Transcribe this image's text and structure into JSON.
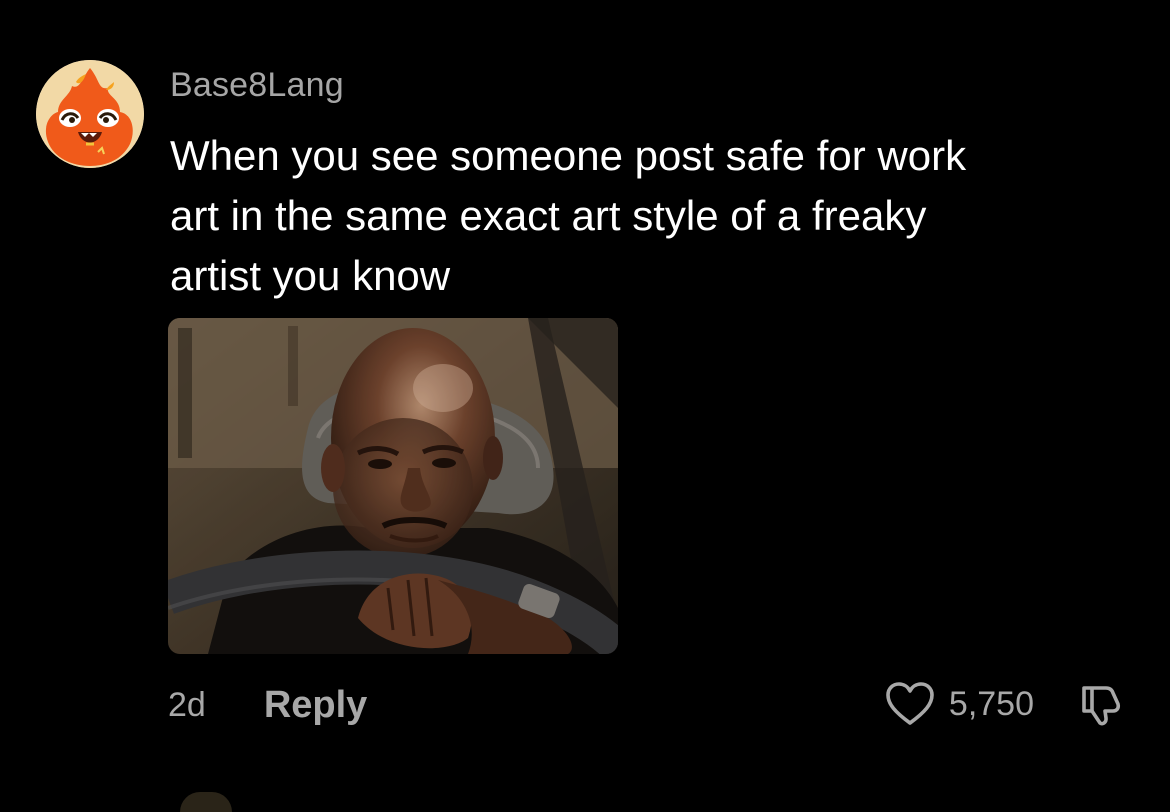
{
  "comment": {
    "username": "Base8Lang",
    "text": "When you see someone post safe for work\nart in the same exact art style of a freaky\nartist you know",
    "timestamp": "2d",
    "reply_label": "Reply",
    "like_count": "5,750",
    "icons": {
      "avatar": "flame-character-avatar",
      "like": "heart-outline-icon",
      "dislike": "thumbs-down-outline-icon"
    }
  },
  "colors": {
    "background": "#000000",
    "primary_text": "#ffffff",
    "secondary_text": "#a8a8a8",
    "avatar_orange": "#f05a1a"
  }
}
